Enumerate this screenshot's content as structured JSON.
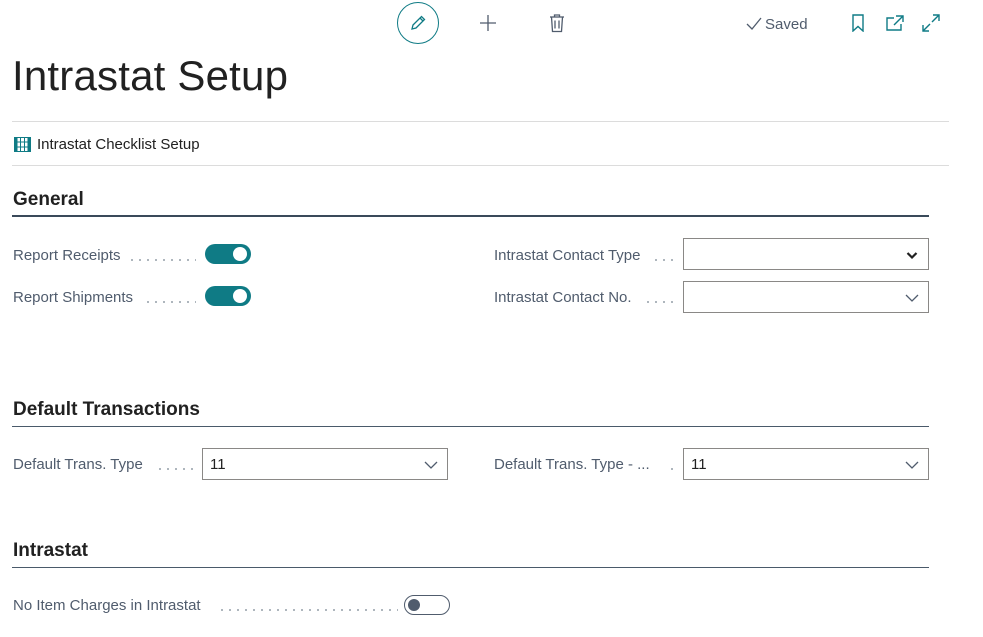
{
  "toolbar": {
    "edit_icon": "pencil-icon",
    "new_icon": "plus-icon",
    "delete_icon": "trash-icon",
    "saved_label": "Saved",
    "bookmark_icon": "bookmark-icon",
    "popout_icon": "open-in-new-window-icon",
    "expand_icon": "expand-icon"
  },
  "page": {
    "title": "Intrastat Setup"
  },
  "actions": {
    "checklist_setup": "Intrastat Checklist Setup"
  },
  "sections": {
    "general": {
      "title": "General",
      "report_receipts": {
        "label": "Report Receipts",
        "value": true
      },
      "report_shipments": {
        "label": "Report Shipments",
        "value": true
      },
      "contact_type": {
        "label": "Intrastat Contact Type",
        "value": ""
      },
      "contact_no": {
        "label": "Intrastat Contact No.",
        "value": ""
      }
    },
    "default_transactions": {
      "title": "Default Transactions",
      "default_trans_type": {
        "label": "Default Trans. Type",
        "value": "11"
      },
      "default_trans_type_return": {
        "label": "Default Trans. Type - ...",
        "value": "11"
      }
    },
    "intrastat": {
      "title": "Intrastat",
      "no_item_charges": {
        "label": "No Item Charges in Intrastat",
        "value": false
      }
    }
  },
  "colors": {
    "accent": "#0f7b85",
    "label": "#505c6d",
    "text": "#212121"
  }
}
